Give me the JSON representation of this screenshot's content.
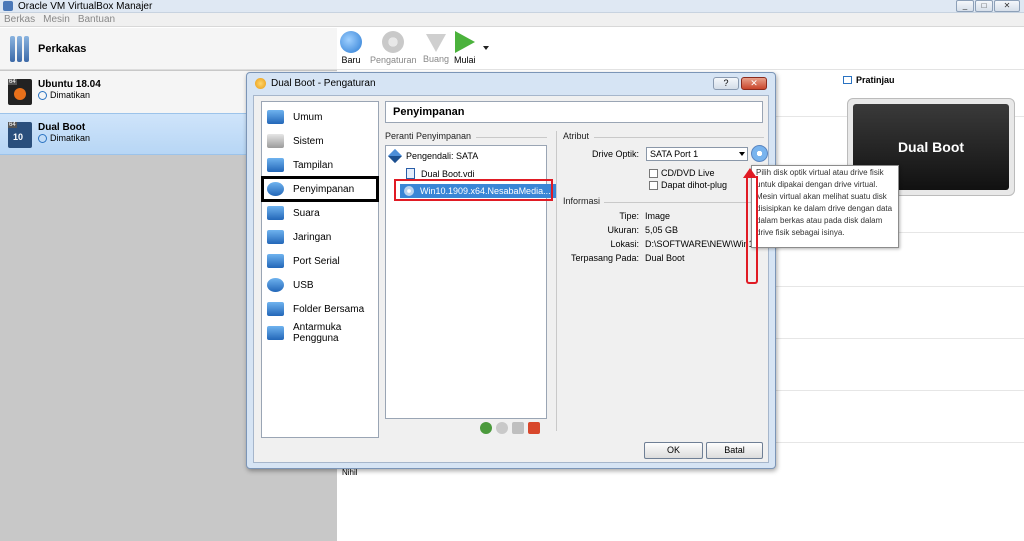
{
  "window": {
    "title": "Oracle VM VirtualBox Manajer",
    "controls": [
      "_",
      "□",
      "✕"
    ]
  },
  "menu": [
    "Berkas",
    "Mesin",
    "Bantuan"
  ],
  "sidebar": {
    "tools_label": "Perkakas",
    "vms": [
      {
        "name": "Ubuntu 18.04",
        "state": "Dimatikan",
        "icon": "ubuntu-64-icon",
        "badge": "64"
      },
      {
        "name": "Dual Boot",
        "state": "Dimatikan",
        "icon": "windows10-64-icon",
        "badge": "64",
        "selected": true
      }
    ]
  },
  "toolbar": {
    "buttons": [
      {
        "label": "Baru",
        "enabled": true
      },
      {
        "label": "Pengaturan",
        "enabled": false
      },
      {
        "label": "Buang",
        "enabled": false
      },
      {
        "label": "Mulai",
        "enabled": true
      }
    ]
  },
  "preview": {
    "title": "Pratinjau",
    "screen_text": "Dual Boot"
  },
  "details": {
    "nihil": "Nihil"
  },
  "dialog": {
    "title": "Dual Boot - Pengaturan",
    "help_label": "?",
    "close_label": "✕",
    "nav": [
      {
        "label": "Umum"
      },
      {
        "label": "Sistem"
      },
      {
        "label": "Tampilan"
      },
      {
        "label": "Penyimpanan",
        "active": true
      },
      {
        "label": "Suara"
      },
      {
        "label": "Jaringan"
      },
      {
        "label": "Port Serial"
      },
      {
        "label": "USB"
      },
      {
        "label": "Folder Bersama"
      },
      {
        "label": "Antarmuka Pengguna"
      }
    ],
    "page_title": "Penyimpanan",
    "storage_devices_label": "Peranti Penyimpanan",
    "tree": {
      "controller": "Pengendali: SATA",
      "items": [
        {
          "label": "Dual Boot.vdi",
          "type": "hard-disk"
        },
        {
          "label": "Win10.1909.x64.NesabaMedia...",
          "type": "optical",
          "selected": true
        }
      ]
    },
    "attributes_label": "Atribut",
    "drive_label": "Drive Optik:",
    "drive_value": "SATA Port 1",
    "checks": [
      {
        "label": "CD/DVD Live",
        "checked": false
      },
      {
        "label": "Dapat dihot-plug",
        "checked": false
      }
    ],
    "info_label": "Informasi",
    "info": [
      {
        "label": "Tipe:",
        "value": "Image"
      },
      {
        "label": "Ukuran:",
        "value": "5,05 GB"
      },
      {
        "label": "Lokasi:",
        "value": "D:\\SOFTWARE\\NEW\\Win10."
      },
      {
        "label": "Terpasang Pada:",
        "value": "Dual Boot"
      }
    ],
    "tooltip": "Pilih disk optik virtual atau drive fisik untuk dipakai dengan drive virtual. Mesin virtual akan melihat suatu disk disisipkan ke dalam drive dengan data dalam berkas atau pada disk dalam drive fisik sebagai isinya.",
    "ok_label": "OK",
    "cancel_label": "Batal"
  }
}
